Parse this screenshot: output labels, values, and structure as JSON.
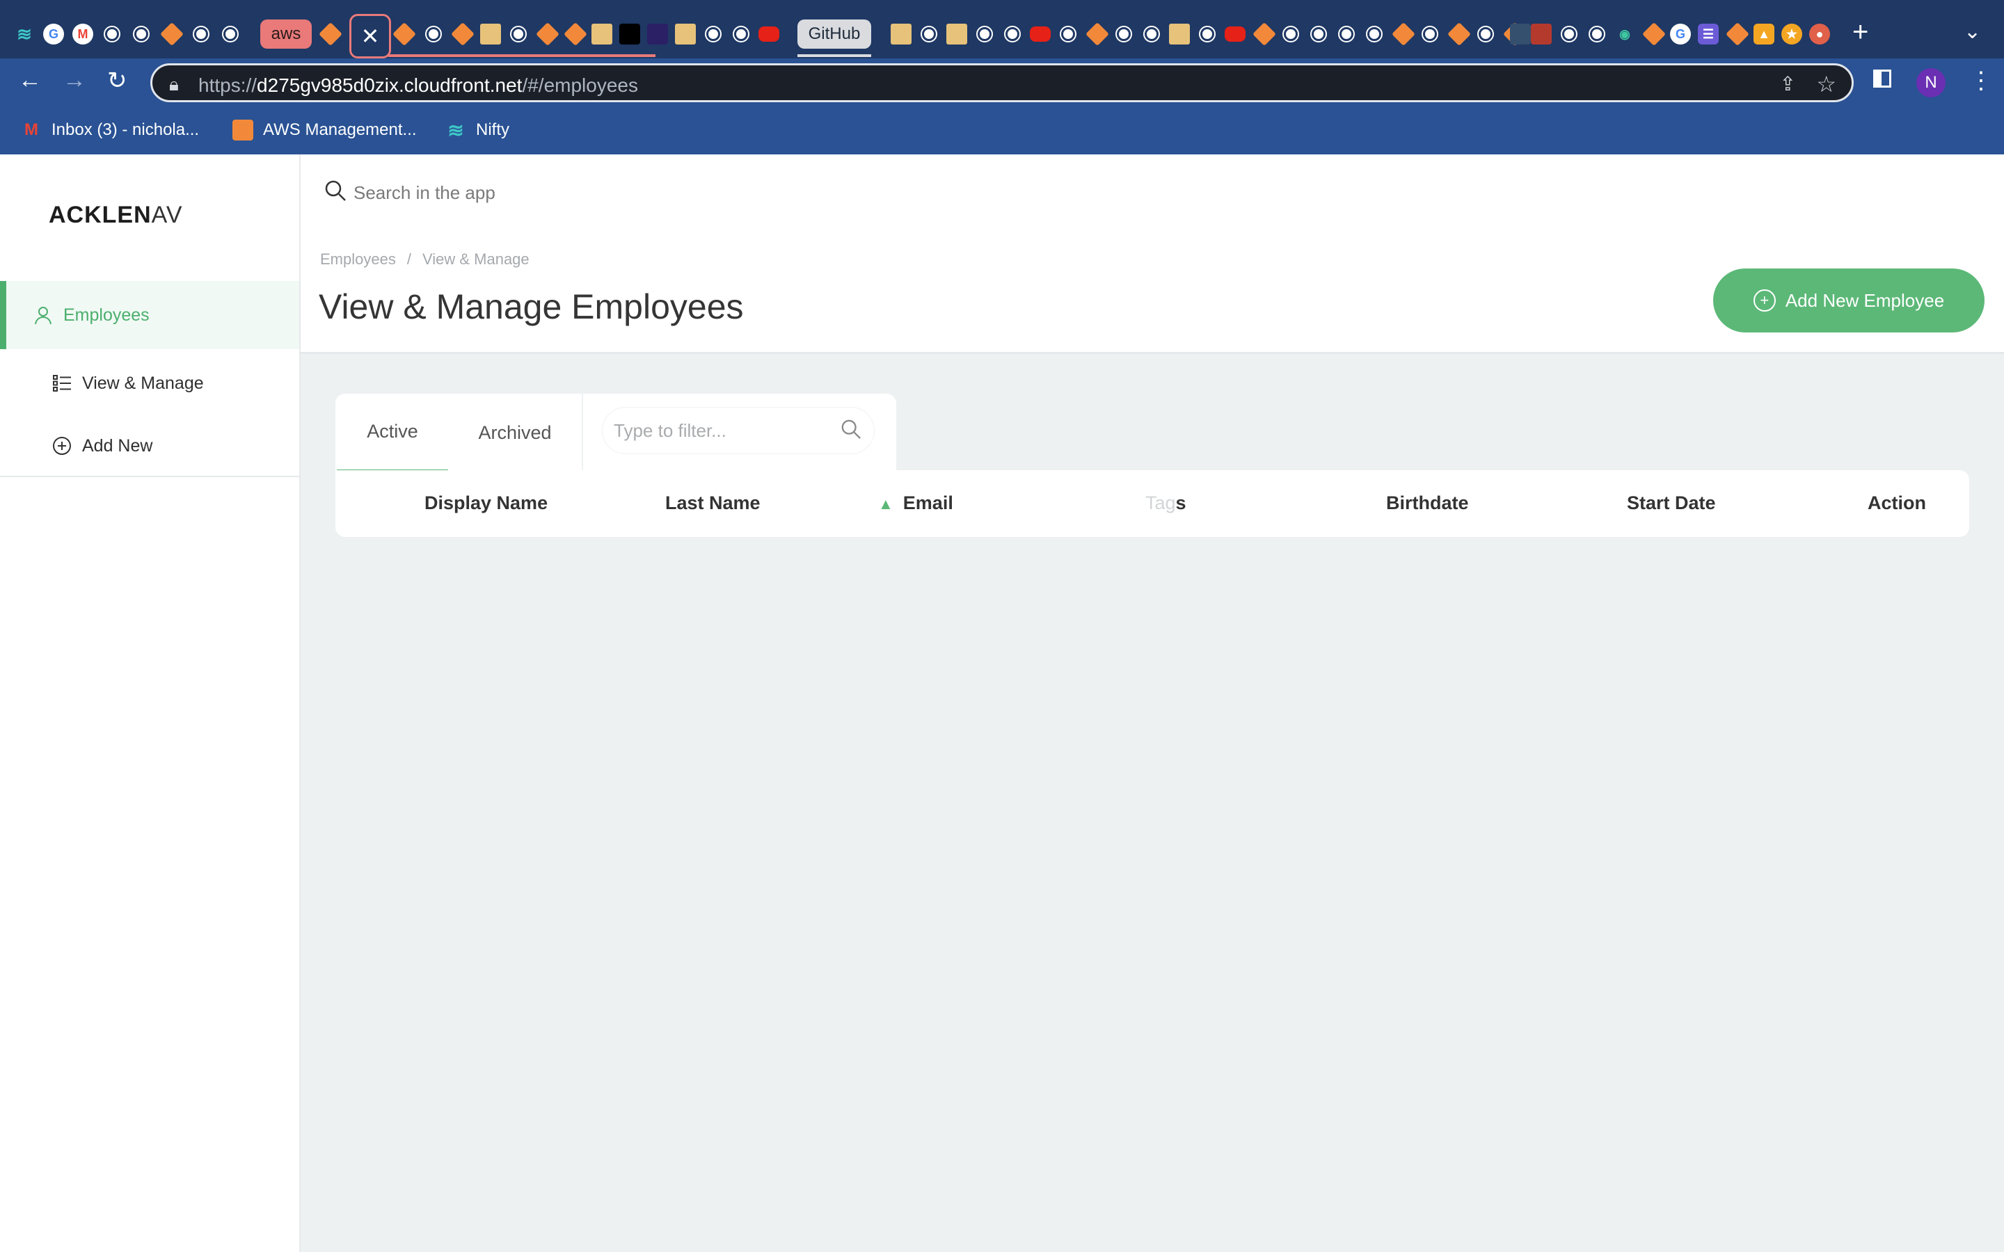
{
  "browser": {
    "tabs": {
      "aws_label": "aws",
      "active_close": "✕",
      "github_label": "GitHub",
      "new_tab": "+",
      "menu": "⌄"
    },
    "url_prefix": "https://",
    "url_host": "d275gv985d0zix.cloudfront.net",
    "url_path": "/#/employees",
    "avatar_letter": "N",
    "bookmarks": [
      {
        "label": "Inbox (3) - nichola...",
        "icon": "gmail-icon"
      },
      {
        "label": "AWS Management...",
        "icon": "aws-box-icon"
      },
      {
        "label": "Nifty",
        "icon": "nifty-icon"
      }
    ]
  },
  "app": {
    "logo_bold": "ACKLEN",
    "logo_light": "AV",
    "nav": {
      "employees": "Employees",
      "view_manage": "View & Manage",
      "add_new": "Add New"
    },
    "search_placeholder": "Search in the app",
    "breadcrumb": [
      "Employees",
      "View & Manage"
    ],
    "breadcrumb_sep": "/",
    "page_title": "View & Manage Employees",
    "add_button": "Add New Employee",
    "tabs": [
      "Active",
      "Archived"
    ],
    "filter_placeholder": "Type to filter...",
    "columns": [
      "Display Name",
      "Last Name",
      "Email",
      "Tags",
      "Birthdate",
      "Start Date",
      "Action"
    ],
    "tags_faint": "Tag",
    "tags_rest": "s",
    "accent_color": "#5cb877"
  }
}
